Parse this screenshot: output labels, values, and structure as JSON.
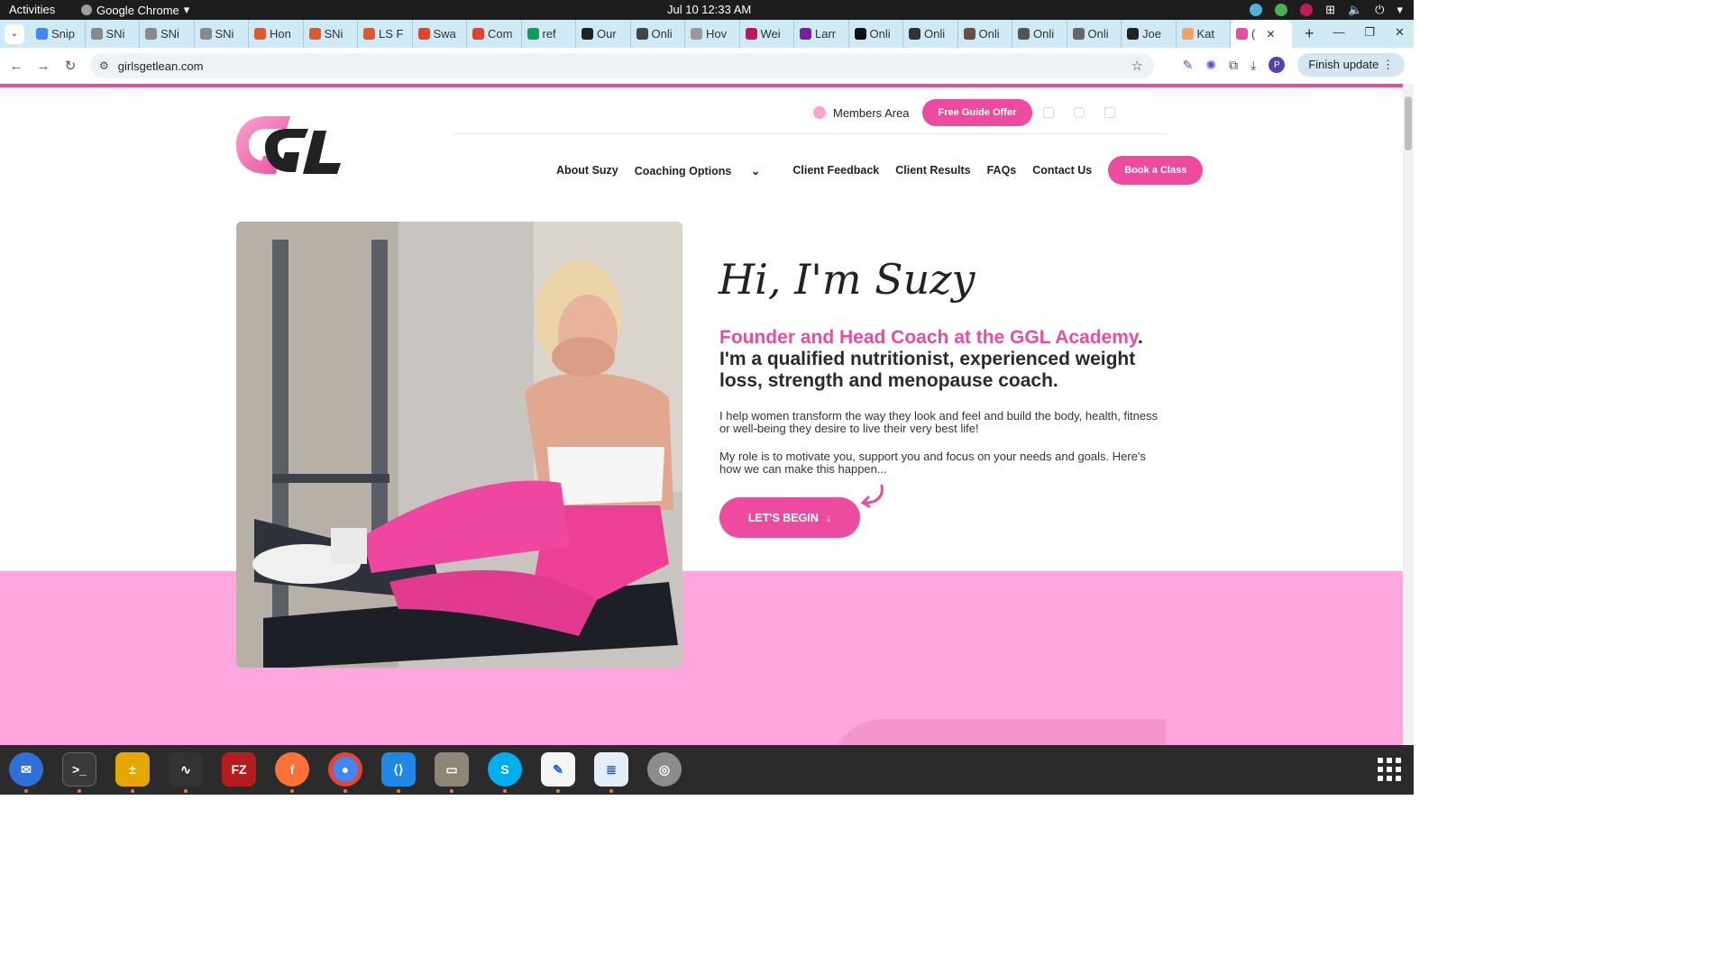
{
  "system": {
    "activities": "Activities",
    "app_name": "Google Chrome",
    "clock": "Jul 10  12:33 AM"
  },
  "tabs": [
    {
      "label": "Snip",
      "color": "#4285f4"
    },
    {
      "label": "SNi",
      "color": "#888888"
    },
    {
      "label": "SNi",
      "color": "#888888"
    },
    {
      "label": "SNi",
      "color": "#888888"
    },
    {
      "label": "Hon",
      "color": "#e4572e"
    },
    {
      "label": "SNi",
      "color": "#e4572e"
    },
    {
      "label": "LS F",
      "color": "#e4572e"
    },
    {
      "label": "Swa",
      "color": "#e24329"
    },
    {
      "label": "Com",
      "color": "#e24329"
    },
    {
      "label": "ref",
      "color": "#0f9d58"
    },
    {
      "label": "Our",
      "color": "#222222"
    },
    {
      "label": "Onli",
      "color": "#444444"
    },
    {
      "label": "Hov",
      "color": "#999999"
    },
    {
      "label": "Wei",
      "color": "#c2185b"
    },
    {
      "label": "Larr",
      "color": "#7b1fa2"
    },
    {
      "label": "Onli",
      "color": "#111111"
    },
    {
      "label": "Onli",
      "color": "#333333"
    },
    {
      "label": "Onli",
      "color": "#6d4c41"
    },
    {
      "label": "Onli",
      "color": "#555555"
    },
    {
      "label": "Onli",
      "color": "#666666"
    },
    {
      "label": "Joe",
      "color": "#222222"
    },
    {
      "label": "Kat",
      "color": "#f4a261"
    }
  ],
  "active_tab": {
    "label": "(",
    "color": "#ec4ba0"
  },
  "address": {
    "url": "girlsgetlean.com",
    "finish_update": "Finish update",
    "avatar_letter": "P"
  },
  "site": {
    "members_area": "Members Area",
    "free_guide": "Free Guide Offer",
    "nav": {
      "about": "About Suzy",
      "coaching": "Coaching Options",
      "feedback": "Client Feedback",
      "results": "Client Results",
      "faqs": "FAQs",
      "contact": "Contact Us",
      "book": "Book a Class"
    },
    "hero": {
      "greeting": "Hi, I'm Suzy",
      "headline_pink": "Founder and Head Coach at the GGL Academy",
      "headline_rest": ". I'm a qualified nutritionist, experienced weight loss, strength and menopause coach.",
      "para1": "I help women transform the way they look and feel and build the body, health, fitness or well-being they desire to live their very best life!",
      "para2": "My role is to motivate you, support you and focus on your needs and goals. Here's how we can make this happen...",
      "cta": "LET'S BEGIN"
    },
    "colors": {
      "brand_pink": "#ec4ba0",
      "band_pink": "#ffa6de"
    }
  }
}
